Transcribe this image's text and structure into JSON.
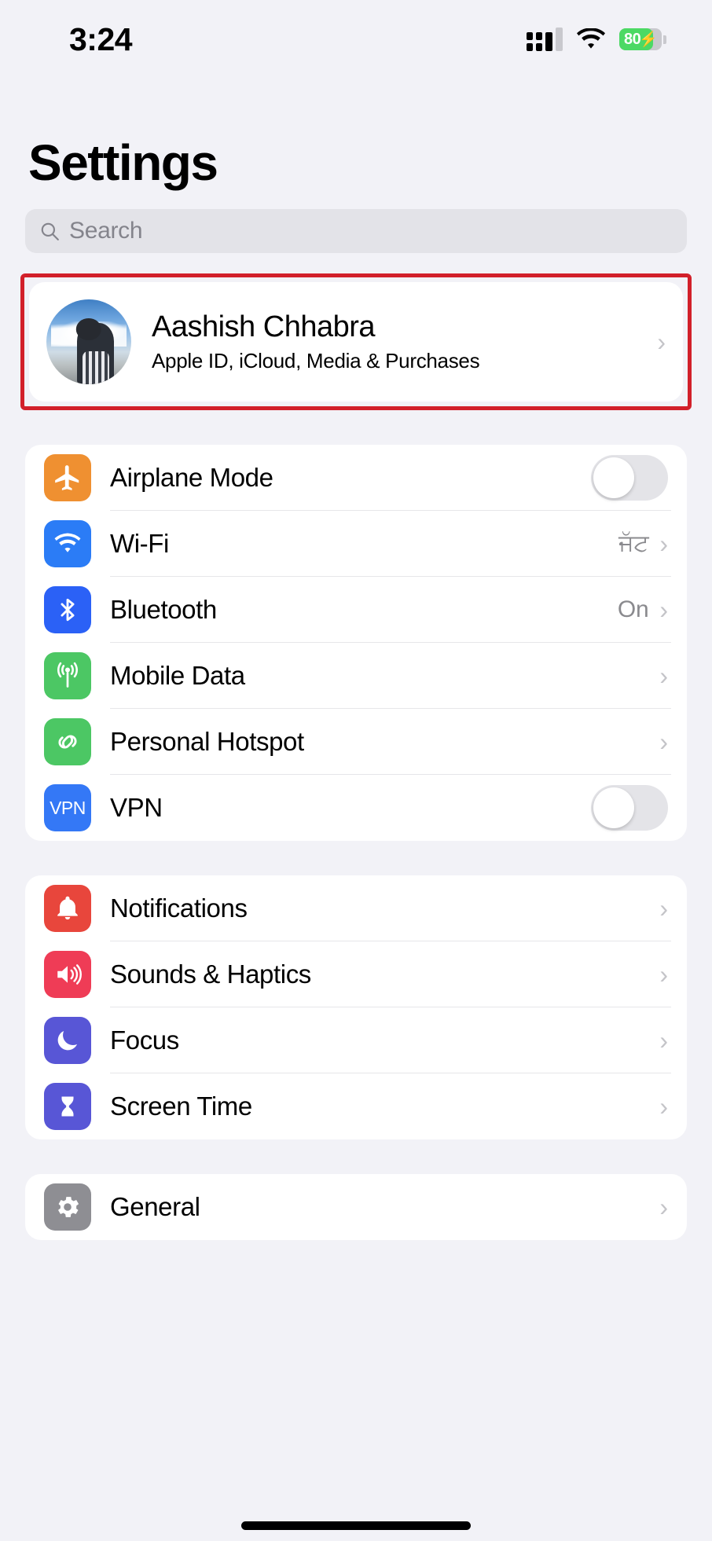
{
  "status_bar": {
    "time": "3:24",
    "signal_icon": "cellular-signal-icon",
    "wifi_icon": "wifi-icon",
    "battery_percent": "80",
    "battery_charging": true,
    "battery_color": "#4cd964"
  },
  "header": {
    "title": "Settings"
  },
  "search": {
    "placeholder": "Search",
    "value": "",
    "icon": "search-icon"
  },
  "profile": {
    "name": "Aashish Chhabra",
    "subtitle": "Apple ID, iCloud, Media & Purchases",
    "avatar_icon": "avatar",
    "chevron": "›",
    "highlight_color": "#d2202a",
    "highlighted": true
  },
  "groups": [
    {
      "id": "connectivity",
      "rows": [
        {
          "label": "Airplane Mode",
          "icon": "airplane-icon",
          "icon_color": "#ef9031",
          "control": "toggle",
          "toggle_on": false,
          "value": ""
        },
        {
          "label": "Wi-Fi",
          "icon": "wifi-icon",
          "icon_color": "#2b7cf6",
          "control": "chevron",
          "value": "ਜੱਟ",
          "chevron": "›"
        },
        {
          "label": "Bluetooth",
          "icon": "bluetooth-icon",
          "icon_color": "#2b61f6",
          "control": "chevron",
          "value": "On",
          "chevron": "›"
        },
        {
          "label": "Mobile Data",
          "icon": "cellular-antenna-icon",
          "icon_color": "#4cc764",
          "control": "chevron",
          "value": "",
          "chevron": "›"
        },
        {
          "label": "Personal Hotspot",
          "icon": "hotspot-link-icon",
          "icon_color": "#4cc764",
          "control": "chevron",
          "value": "",
          "chevron": "›"
        },
        {
          "label": "VPN",
          "icon": "vpn-icon",
          "icon_color": "#3478f6",
          "icon_text": "VPN",
          "control": "toggle",
          "toggle_on": false,
          "value": ""
        }
      ]
    },
    {
      "id": "alerts",
      "rows": [
        {
          "label": "Notifications",
          "icon": "bell-icon",
          "icon_color": "#e8463c",
          "control": "chevron",
          "value": "",
          "chevron": "›"
        },
        {
          "label": "Sounds & Haptics",
          "icon": "speaker-icon",
          "icon_color": "#ef3c56",
          "control": "chevron",
          "value": "",
          "chevron": "›"
        },
        {
          "label": "Focus",
          "icon": "moon-icon",
          "icon_color": "#5856d6",
          "control": "chevron",
          "value": "",
          "chevron": "›"
        },
        {
          "label": "Screen Time",
          "icon": "hourglass-icon",
          "icon_color": "#5856d6",
          "control": "chevron",
          "value": "",
          "chevron": "›"
        }
      ]
    },
    {
      "id": "system",
      "rows": [
        {
          "label": "General",
          "icon": "gear-icon",
          "icon_color": "#8e8e93",
          "control": "chevron",
          "value": "",
          "chevron": "›"
        }
      ]
    }
  ]
}
